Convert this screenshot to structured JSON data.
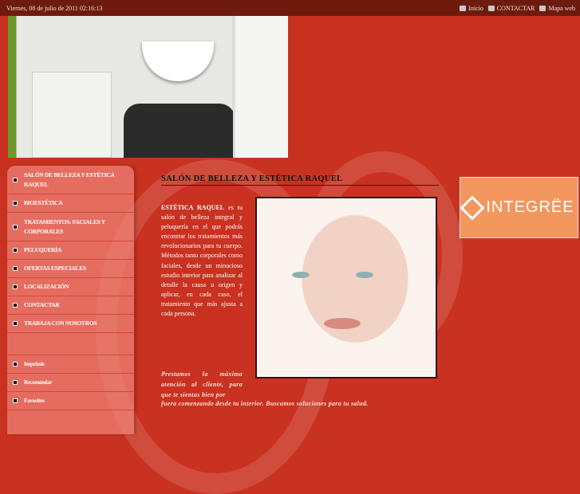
{
  "topbar": {
    "date": "Viernes, 08 de julio de 2011 02:16:13",
    "links": [
      {
        "label": "Inicio",
        "icon": "home-icon"
      },
      {
        "label": "CONTACTAR",
        "icon": "mail-icon"
      },
      {
        "label": "Mapa web",
        "icon": "sitemap-icon"
      }
    ]
  },
  "menu": [
    "SALÓN DE BELLEZA Y ESTÉTICA RAQUEL",
    "BIOESTÉTICA",
    "TRATAMIENTOS: FACIALES Y CORPORALES",
    "PELUQUERÍA",
    "OFERTAS ESPECIALES",
    "LOCALIZACIÓN",
    "CONTACTAR",
    "TRABAJA CON NOSOTROS"
  ],
  "tools": [
    "Imprimir",
    "Recomendar",
    "Favoritos"
  ],
  "main": {
    "title": "SALÓN DE BELLEZA Y ESTÉTICA RAQUEL",
    "intro_bold": "ESTÉTICA RAQUEL",
    "intro_rest": " es tu salón de belleza integral y peluquería en el que podrás encontrar los tratamientos más revolucionarios para tu cuerpo. Métodos tanto corporales como faciales, desde un minucioso estudio interior para analizar al detalle la causa u origen y aplicar, en cada caso, el tratamiento que más ajusta a cada persona.",
    "slogan_1": "Prestamos la máxima atención al cliente, para que te sientas bien por",
    "slogan_2": "fuera comenzando desde tu interior. Buscamos soluciones para tu salud."
  },
  "banner": {
    "logo_text": "INTEGRËE"
  }
}
